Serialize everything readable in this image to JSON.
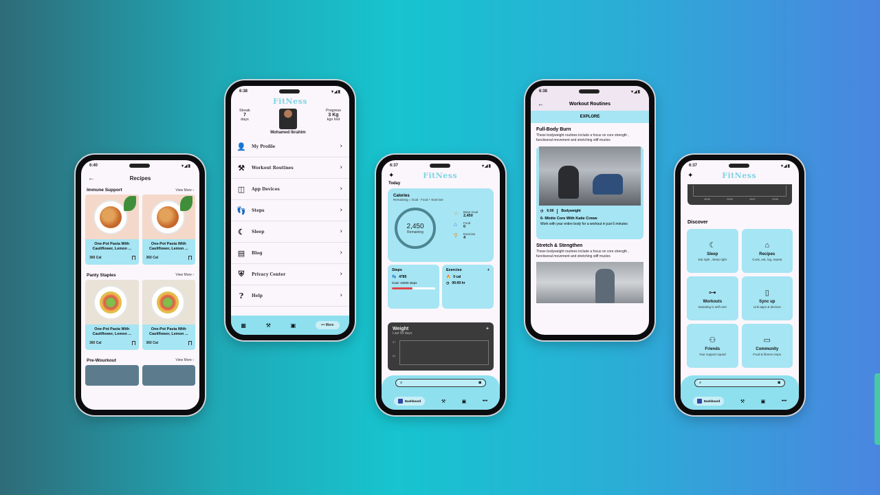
{
  "phone1": {
    "status_time": "6:40",
    "title": "Recipes",
    "sections": [
      {
        "title": "Immune Support",
        "view_more": "View More",
        "cards": [
          {
            "name": "One-Pot Pasta With Cauliflower, Lemon ...",
            "cal": "360 Cal"
          },
          {
            "name": "One-Pot Pasta With Cauliflower, Lemon ...",
            "cal": "360 Cal"
          }
        ]
      },
      {
        "title": "Panty Staples",
        "view_more": "View More",
        "cards": [
          {
            "name": "One-Pot Pasta With Cauliflower, Lemon ...",
            "cal": "360 Cal"
          },
          {
            "name": "One-Pot Pasta With Cauliflower, Lemon ...",
            "cal": "360 Cal"
          }
        ]
      },
      {
        "title": "Pre-Wourkout",
        "view_more": "View More"
      }
    ]
  },
  "phone2": {
    "status_time": "6:38",
    "logo": "FitNess",
    "streak_label": "Streak",
    "streak_value": "7",
    "streak_unit": "days",
    "progress_label": "Progress",
    "progress_value": "3 Kg",
    "progress_unit": "kgs lost",
    "name": "Mohamed Ibrahim",
    "menu": [
      {
        "label": "My Profile",
        "icon": "person-icon"
      },
      {
        "label": "Workout Routines",
        "icon": "workout-icon"
      },
      {
        "label": "App Devices",
        "icon": "devices-icon"
      },
      {
        "label": "Steps",
        "icon": "footsteps-icon"
      },
      {
        "label": "Sleep",
        "icon": "moon-icon"
      },
      {
        "label": "Blog",
        "icon": "blog-icon"
      },
      {
        "label": "Privacy Center",
        "icon": "shield-icon"
      },
      {
        "label": "Help",
        "icon": "help-icon"
      }
    ],
    "more_label": "More"
  },
  "phone3": {
    "status_time": "6:37",
    "logo": "FitNess",
    "today": "Today",
    "calories_title": "Calories",
    "calories_formula": "Remaining = Goal - Food + Exercise",
    "remaining_value": "2,450",
    "remaining_label": "Remaining",
    "base_goal_label": "Base Goal",
    "base_goal_value": "2,450",
    "food_label": "Food",
    "food_value": "0",
    "exercise_label": "Exercise",
    "exercise_value": "4",
    "steps_title": "Steps",
    "steps_value": "4785",
    "steps_goal": "Goal: 10000 steps",
    "steps_progress": 0.4785,
    "exercise_card_title": "Exercise",
    "exercise_cal": "0 cal",
    "exercise_time": "00:00 hr",
    "weight_title": "Weight",
    "weight_sub": "Last 90 days",
    "weight_axis_top": "87",
    "weight_axis_mid": "82",
    "nav_dashboard": "Dashboard"
  },
  "phone4": {
    "status_time": "6:38",
    "title": "Workout Routines",
    "explore": "EXPLORE",
    "sec1_title": "Full-Body Burn",
    "sec1_desc": "These bodyweight routines include a focus on core strength , functisonal movement and stretching stiff mucles",
    "card_time": "6:00",
    "card_type": "Bodyweight",
    "card_title": "6- Minite Core With Katie Crewe",
    "card_desc": "Work with your entire body for a workout in just 6 minutes",
    "sec2_title": "Stretch & Stengthen",
    "sec2_desc": "These bodyweight routines include a focus on core strength , functisonal movement and stretching stiff mucles"
  },
  "phone5": {
    "status_time": "6:37",
    "logo": "FitNess",
    "chart_labels": [
      "30/06",
      "29/06",
      "29/07",
      "29/08"
    ],
    "discover": "Discover",
    "tiles": [
      {
        "title": "Sleep",
        "sub": "Eat right , sleep right",
        "icon": "moon-icon"
      },
      {
        "title": "Recipes",
        "sub": "Cook, eat, log, repeat",
        "icon": "home-icon"
      },
      {
        "title": "Workouts",
        "sub": "Sweating is self-care",
        "icon": "dumbbell-icon"
      },
      {
        "title": "Sync up",
        "sub": "Link apps & devices",
        "icon": "phone-icon"
      },
      {
        "title": "Friends",
        "sub": "Your support squad",
        "icon": "friends-icon"
      },
      {
        "title": "Community",
        "sub": "Food & fitness Inspo",
        "icon": "chat-icon"
      }
    ],
    "nav_dashboard": "Dashboard"
  }
}
